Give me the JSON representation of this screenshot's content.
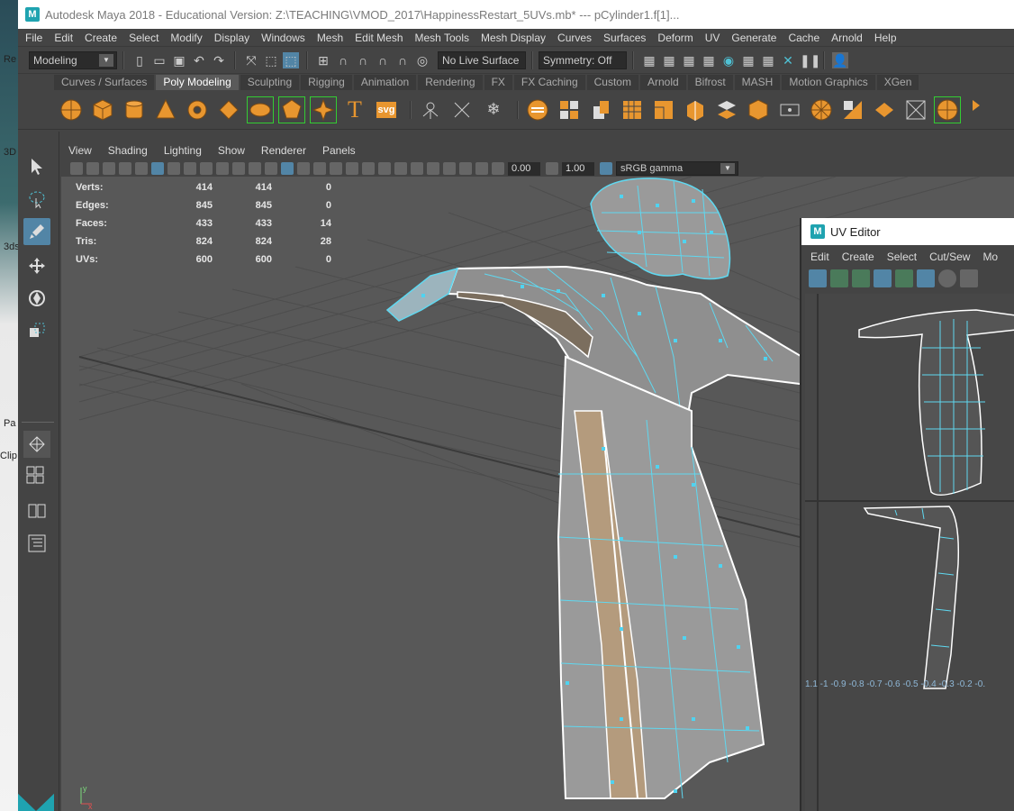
{
  "desktop": {
    "labels": [
      "Re",
      "3D",
      "3ds",
      "Pa",
      "Clip"
    ]
  },
  "title": {
    "app": "Autodesk Maya 2018 - Educational Version: Z:\\TEACHING\\VMOD_2017\\HappinessRestart_5UVs.mb*   ---   pCylinder1.f[1]..."
  },
  "menubar": [
    "File",
    "Edit",
    "Create",
    "Select",
    "Modify",
    "Display",
    "Windows",
    "Mesh",
    "Edit Mesh",
    "Mesh Tools",
    "Mesh Display",
    "Curves",
    "Surfaces",
    "Deform",
    "UV",
    "Generate",
    "Cache",
    "Arnold",
    "Help"
  ],
  "statusline": {
    "mode": "Modeling",
    "surface_field": "No Live Surface",
    "symmetry": "Symmetry: Off"
  },
  "shelf_tabs": [
    "Curves / Surfaces",
    "Poly Modeling",
    "Sculpting",
    "Rigging",
    "Animation",
    "Rendering",
    "FX",
    "FX Caching",
    "Custom",
    "Arnold",
    "Bifrost",
    "MASH",
    "Motion Graphics",
    "XGen"
  ],
  "active_shelf_tab": "Poly Modeling",
  "shelf_text_icons": {
    "type": "T",
    "svg": "svg"
  },
  "panel_menu": [
    "View",
    "Shading",
    "Lighting",
    "Show",
    "Renderer",
    "Panels"
  ],
  "panel_toolbar": {
    "exposure": "0.00",
    "gamma": "1.00",
    "colorspace": "sRGB gamma"
  },
  "hud": {
    "rows": [
      {
        "label": "Verts:",
        "a": "414",
        "b": "414",
        "c": "0"
      },
      {
        "label": "Edges:",
        "a": "845",
        "b": "845",
        "c": "0"
      },
      {
        "label": "Faces:",
        "a": "433",
        "b": "433",
        "c": "14"
      },
      {
        "label": "Tris:",
        "a": "824",
        "b": "824",
        "c": "28"
      },
      {
        "label": "UVs:",
        "a": "600",
        "b": "600",
        "c": "0"
      }
    ]
  },
  "uv_editor": {
    "title": "UV Editor",
    "menu": [
      "Edit",
      "Create",
      "Select",
      "Cut/Sew",
      "Mo"
    ],
    "axis_labels": "1.1 -1  -0.9 -0.8 -0.7 -0.6 -0.5 -0.4 -0.3 -0.2 -0."
  },
  "colors": {
    "wire": "#5fd8f0",
    "selected_face": "#c8a27a",
    "viewport_bg": "#585858",
    "accent": "#1fa3b0"
  }
}
